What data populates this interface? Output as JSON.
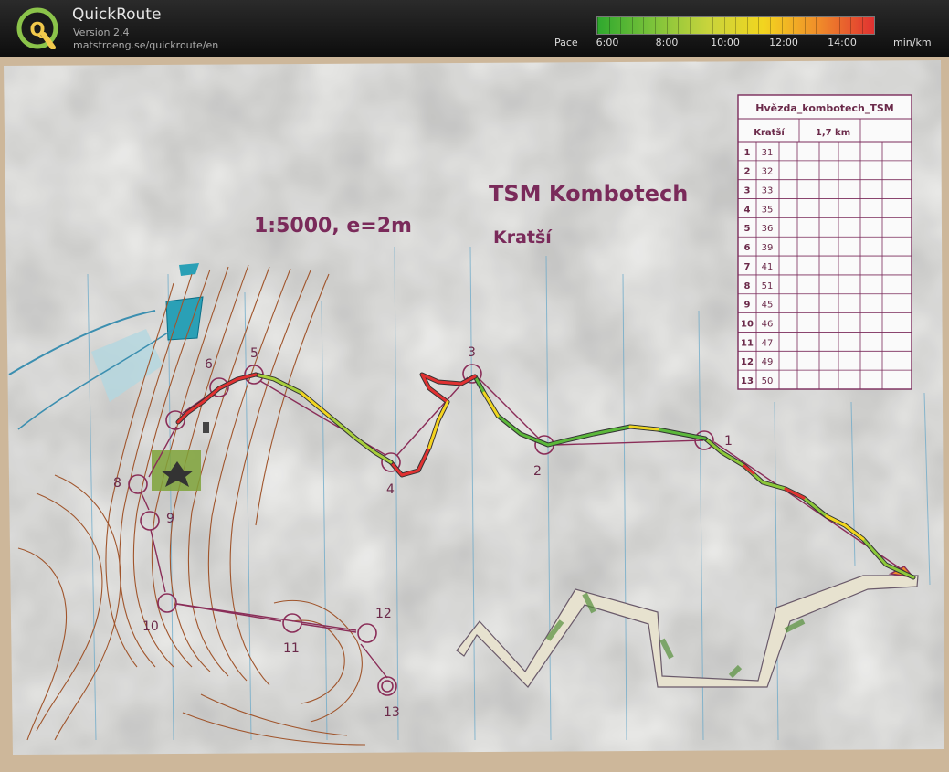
{
  "header": {
    "logo_letter": "Q",
    "app_title": "QuickRoute",
    "version": "Version 2.4",
    "url": "matstroeng.se/quickroute/en"
  },
  "pace_legend": {
    "label": "Pace",
    "ticks": [
      "6:00",
      "8:00",
      "10:00",
      "12:00",
      "14:00"
    ],
    "unit": "min/km",
    "colors": [
      "#2ea82e",
      "#7cc33a",
      "#c8d43c",
      "#f2d51f",
      "#f08c2a",
      "#e03131"
    ]
  },
  "map": {
    "paper_color": "#f1f1ef",
    "contour_color": "#a0552c",
    "overprint_color": "#8a2d58",
    "title": "TSM Kombotech",
    "course": "Kratší",
    "scale_text": "1:5000, e=2m",
    "control_labels": [
      "1",
      "2",
      "3",
      "4",
      "5",
      "6",
      "8",
      "9",
      "10",
      "11",
      "12",
      "13"
    ],
    "description_sheet": {
      "event": "Hvězda_kombotech_TSM",
      "course": "Kratší",
      "length": "1,7 km",
      "controls": [
        {
          "num": "1",
          "code": "31"
        },
        {
          "num": "2",
          "code": "32"
        },
        {
          "num": "3",
          "code": "33"
        },
        {
          "num": "4",
          "code": "35"
        },
        {
          "num": "5",
          "code": "36"
        },
        {
          "num": "6",
          "code": "39"
        },
        {
          "num": "7",
          "code": "41"
        },
        {
          "num": "8",
          "code": "51"
        },
        {
          "num": "9",
          "code": "45"
        },
        {
          "num": "10",
          "code": "46"
        },
        {
          "num": "11",
          "code": "47"
        },
        {
          "num": "12",
          "code": "49"
        },
        {
          "num": "13",
          "code": "50"
        }
      ]
    }
  }
}
